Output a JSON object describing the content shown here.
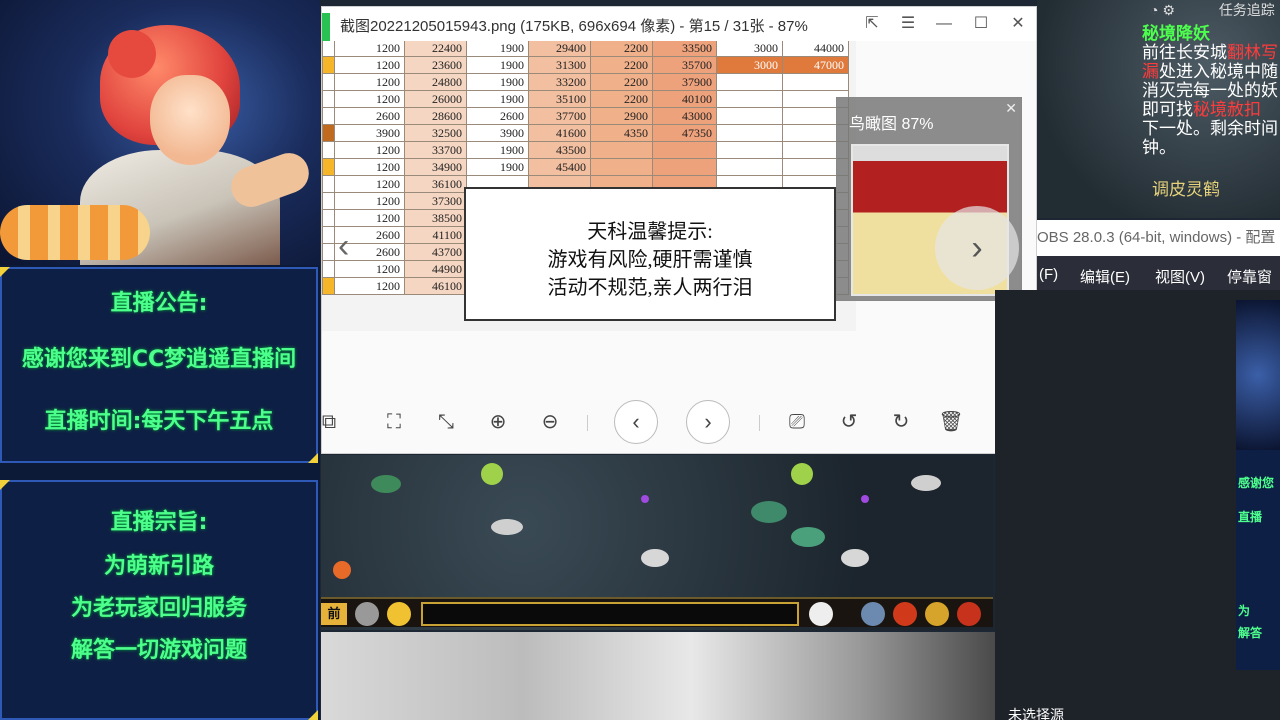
{
  "stream_overlay": {
    "notice_title": "直播公告:",
    "notice_welcome": "感谢您来到CC梦逍遥直播间",
    "notice_time": "直播时间:每天下午五点",
    "purpose_title": "直播宗旨:",
    "purpose_lines": [
      "为萌新引路",
      "为老玩家回归服务",
      "解答一切游戏问题"
    ]
  },
  "viewer": {
    "title": "截图20221205015943.png (175KB, 696x694 像素) - 第15 / 31张 - 87%",
    "birdseye_label": "鸟瞰图  87%",
    "sheet_rows": [
      {
        "style": "",
        "c": [
          "1200",
          "22400",
          "1900",
          "29400",
          "2200",
          "33500",
          "3000",
          "44000"
        ]
      },
      {
        "style": "mark hl",
        "c": [
          "1200",
          "23600",
          "1900",
          "31300",
          "2200",
          "35700",
          "3000",
          "47000"
        ]
      },
      {
        "style": "",
        "c": [
          "1200",
          "24800",
          "1900",
          "33200",
          "2200",
          "37900",
          "",
          ""
        ]
      },
      {
        "style": "",
        "c": [
          "1200",
          "26000",
          "1900",
          "35100",
          "2200",
          "40100",
          "",
          ""
        ]
      },
      {
        "style": "",
        "c": [
          "2600",
          "28600",
          "2600",
          "37700",
          "2900",
          "43000",
          "",
          ""
        ]
      },
      {
        "style": "mark2",
        "c": [
          "3900",
          "32500",
          "3900",
          "41600",
          "4350",
          "47350",
          "",
          ""
        ]
      },
      {
        "style": "",
        "c": [
          "1200",
          "33700",
          "1900",
          "43500",
          "",
          "",
          "",
          ""
        ]
      },
      {
        "style": "mark",
        "c": [
          "1200",
          "34900",
          "1900",
          "45400",
          "",
          "",
          "",
          ""
        ]
      },
      {
        "style": "",
        "c": [
          "1200",
          "36100",
          "",
          "",
          "",
          "",
          "",
          ""
        ]
      },
      {
        "style": "",
        "c": [
          "1200",
          "37300",
          "",
          "",
          "",
          "",
          "",
          ""
        ]
      },
      {
        "style": "",
        "c": [
          "1200",
          "38500",
          "",
          "",
          "",
          "",
          "",
          ""
        ]
      },
      {
        "style": "",
        "c": [
          "2600",
          "41100",
          "",
          "",
          "",
          "",
          "",
          ""
        ]
      },
      {
        "style": "",
        "c": [
          "2600",
          "43700",
          "",
          "",
          "",
          "",
          "",
          ""
        ]
      },
      {
        "style": "",
        "c": [
          "1200",
          "44900",
          "",
          "",
          "",
          "",
          "",
          ""
        ]
      },
      {
        "style": "mark",
        "c": [
          "1200",
          "46100",
          "",
          "",
          "",
          "",
          "",
          ""
        ]
      }
    ],
    "warning": {
      "line1": "天科温馨提示:",
      "line2": "游戏有风险,硬肝需谨慎",
      "line3": "活动不规范,亲人两行泪"
    }
  },
  "game": {
    "bar_label": "前"
  },
  "right_game": {
    "quest_title": "秘境降妖",
    "quest_text_1": "前往长安城",
    "quest_red_1": "翻林写",
    "quest_red_2": "漏",
    "quest_text_2": "处进入秘境中随",
    "quest_text_3": "消灭完每一处的妖",
    "quest_text_4": "即可找",
    "quest_red_3": "秘境赦扣",
    "quest_text_5": "下一处。剩余时间",
    "quest_text_6": "钟。",
    "npc_name": "调皮灵鹤",
    "top_text": "任务追踪"
  },
  "obs": {
    "title": "OBS 28.0.3 (64-bit, windows) - 配置",
    "menu_file": "(F)",
    "menu_edit": "编辑(E)",
    "menu_view": "视图(V)",
    "menu_dock": "停靠窗",
    "preview_text_1": "感谢您",
    "preview_text_2": "直播",
    "preview_text_3": "为",
    "preview_text_4": "解答",
    "no_source": "未选择源"
  }
}
